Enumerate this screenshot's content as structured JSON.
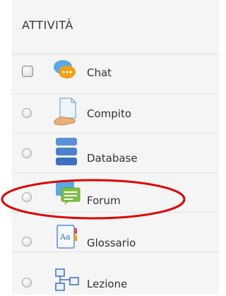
{
  "section": {
    "title": "ATTIVITÀ"
  },
  "activities": [
    {
      "label": "Chat",
      "icon": "chat-icon"
    },
    {
      "label": "Compito",
      "icon": "assignment-icon"
    },
    {
      "label": "Database",
      "icon": "database-icon"
    },
    {
      "label": "Forum",
      "icon": "forum-icon"
    },
    {
      "label": "Glossario",
      "icon": "glossary-icon"
    },
    {
      "label": "Lezione",
      "icon": "lesson-icon"
    }
  ],
  "highlight_color": "#e00000"
}
